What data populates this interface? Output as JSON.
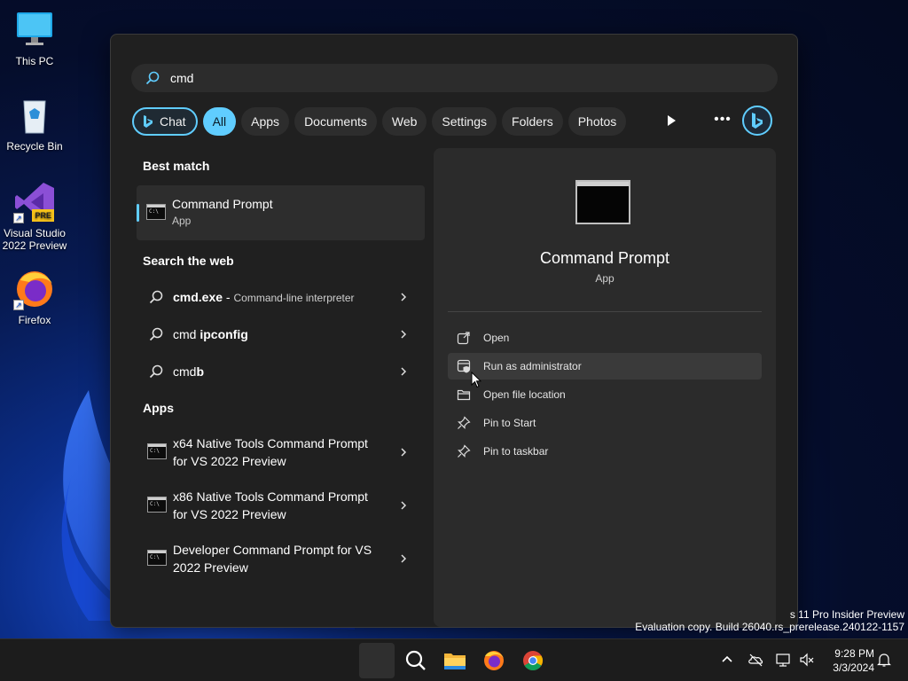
{
  "desktop": {
    "icons": [
      {
        "label": "This PC",
        "icon": "computer-icon"
      },
      {
        "label": "Recycle Bin",
        "icon": "recycle-bin-icon"
      },
      {
        "label": "Visual Studio 2022 Preview",
        "icon": "visual-studio-icon",
        "badge": "PRE"
      },
      {
        "label": "Firefox",
        "icon": "firefox-icon"
      }
    ],
    "watermark": {
      "line1": "s 11 Pro Insider Preview",
      "line2": "Evaluation copy. Build 26040.rs_prerelease.240122-1157"
    }
  },
  "search": {
    "query": "cmd",
    "filters": [
      "Chat",
      "All",
      "Apps",
      "Documents",
      "Web",
      "Settings",
      "Folders",
      "Photos"
    ],
    "active_filter": "All"
  },
  "results": {
    "best_match_heading": "Best match",
    "best_match": {
      "title": "Command Prompt",
      "subtitle": "App"
    },
    "web_heading": "Search the web",
    "web": [
      {
        "prefix": "",
        "bold": "cmd.exe",
        "suffix": " - ",
        "desc": "Command-line interpreter"
      },
      {
        "prefix": "cmd ",
        "bold": "ipconfig",
        "suffix": "",
        "desc": ""
      },
      {
        "prefix": "cmd",
        "bold": "b",
        "suffix": "",
        "desc": ""
      }
    ],
    "apps_heading": "Apps",
    "apps": [
      {
        "label": "x64 Native Tools Command Prompt for VS 2022 Preview"
      },
      {
        "label": "x86 Native Tools Command Prompt for VS 2022 Preview"
      },
      {
        "label": "Developer Command Prompt for VS 2022 Preview"
      }
    ]
  },
  "details": {
    "title": "Command Prompt",
    "subtitle": "App",
    "actions": [
      {
        "label": "Open",
        "icon": "open-external-icon"
      },
      {
        "label": "Run as administrator",
        "icon": "shield-admin-icon"
      },
      {
        "label": "Open file location",
        "icon": "folder-icon"
      },
      {
        "label": "Pin to Start",
        "icon": "pin-icon"
      },
      {
        "label": "Pin to taskbar",
        "icon": "pin-icon"
      }
    ]
  },
  "taskbar": {
    "time": "9:28 PM",
    "date": "3/3/2024"
  },
  "colors": {
    "accent": "#60cdff",
    "panel": "#202020",
    "details": "#2b2b2b"
  }
}
